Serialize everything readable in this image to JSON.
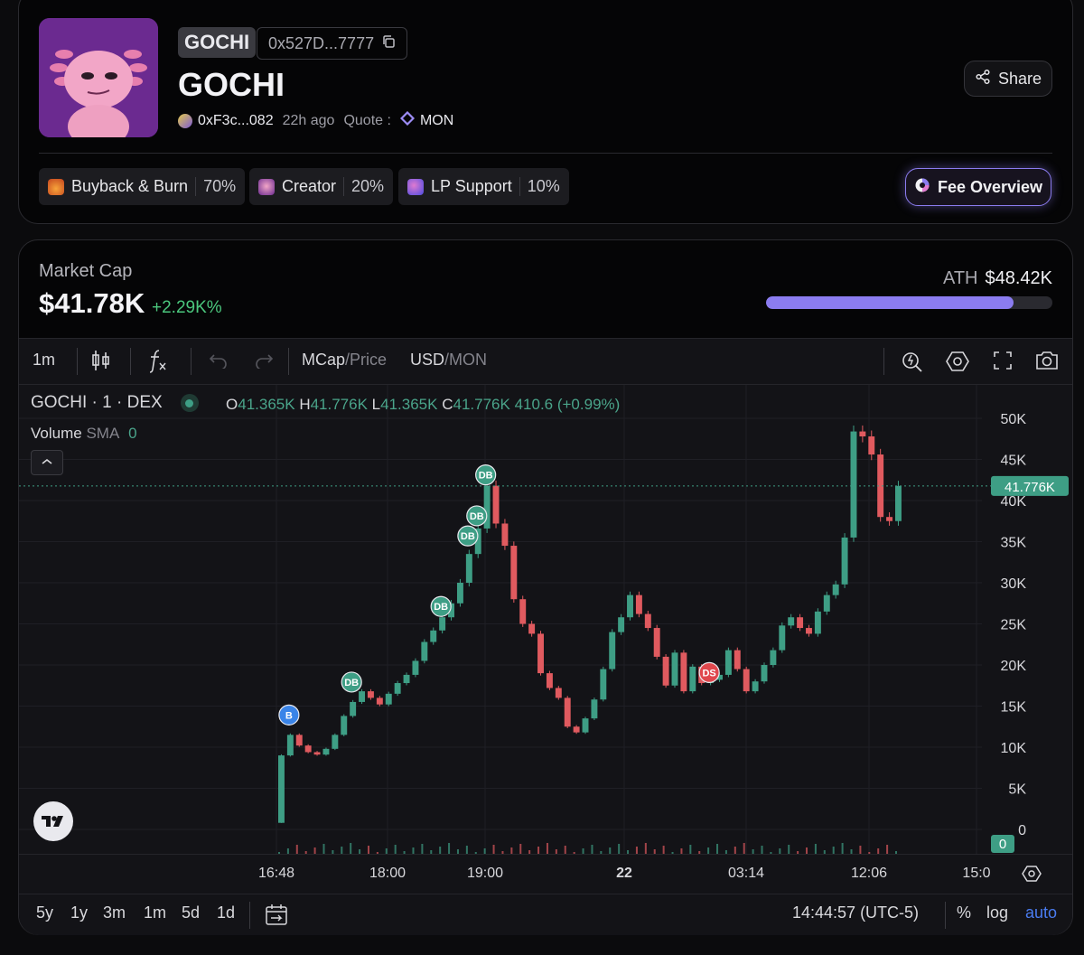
{
  "token": {
    "symbol": "GOCHI",
    "address_short": "0x527D...7777",
    "name": "GOCHI",
    "creator": "0xF3c...082",
    "age": "22h ago",
    "quote_label": "Quote :",
    "quote_value": "MON",
    "share_label": "Share"
  },
  "fees": [
    {
      "label": "Buyback & Burn",
      "pct": "70%",
      "icon": "fire-icon",
      "color": "#e0692a"
    },
    {
      "label": "Creator",
      "pct": "20%",
      "icon": "creator-avatar-icon",
      "color": "#b35cd8"
    },
    {
      "label": "LP Support",
      "pct": "10%",
      "icon": "lp-icon",
      "color": "#6a6ae8"
    }
  ],
  "fee_overview_label": "Fee Overview",
  "market": {
    "label": "Market Cap",
    "value": "$41.78K",
    "change": "+2.29K%",
    "ath_label": "ATH",
    "ath_value": "$48.42K",
    "ath_progress": 0.863
  },
  "toolbar": {
    "interval": "1m",
    "mcap": "MCap",
    "price": "Price",
    "usd": "USD",
    "mon": "MON",
    "slash": "/"
  },
  "legend": {
    "series": "GOCHI · 1 · DEX",
    "o_label": "O",
    "o": "41.365K",
    "h_label": "H",
    "h": "41.776K",
    "l_label": "L",
    "l": "41.365K",
    "c_label": "C",
    "c": "41.776K",
    "chg": "410.6 (+0.99%)",
    "volume_label": "Volume",
    "volume_sma": "SMA",
    "volume_value": "0"
  },
  "chart_data": {
    "type": "candlestick",
    "y_axis_ticks": [
      "50K",
      "45K",
      "40K",
      "35K",
      "30K",
      "25K",
      "20K",
      "15K",
      "10K",
      "5K",
      "0"
    ],
    "ylim": [
      0,
      50000
    ],
    "x_axis_ticks": [
      "16:48",
      "18:00",
      "19:00",
      "22",
      "03:14",
      "12:06",
      "15:0"
    ],
    "last_price_label": "41.776K",
    "volume_label": "0",
    "close_series": [
      9000,
      11500,
      10200,
      9400,
      9100,
      9800,
      11500,
      13800,
      15500,
      16800,
      16000,
      15200,
      16500,
      17800,
      18800,
      20500,
      22800,
      24200,
      25800,
      27500,
      30000,
      33500,
      36600,
      41800,
      37200,
      34500,
      28000,
      25000,
      23800,
      19000,
      17200,
      16000,
      12500,
      11800,
      13500,
      15800,
      19500,
      24000,
      25800,
      28500,
      26200,
      24500,
      21000,
      17500,
      21500,
      16800,
      19800,
      17800,
      18200,
      18800,
      21800,
      19500,
      16800,
      18000,
      20000,
      21800,
      24800,
      25800,
      24500,
      23800,
      26500,
      28500,
      29800,
      35500,
      48400,
      47800,
      45600,
      38000,
      37500,
      41776
    ],
    "markers": [
      {
        "label": "B",
        "type": "buy"
      },
      {
        "label": "DB",
        "type": "dev-buy"
      },
      {
        "label": "DB",
        "type": "dev-buy"
      },
      {
        "label": "DB",
        "type": "dev-buy"
      },
      {
        "label": "DB",
        "type": "dev-buy"
      },
      {
        "label": "DB",
        "type": "dev-buy"
      },
      {
        "label": "DS",
        "type": "dev-sell"
      }
    ],
    "colors": {
      "up": "#3e9e85",
      "down": "#e05a5f",
      "buy": "#3a84e8",
      "dev_buy": "#3e9e85",
      "dev_sell": "#e0474d"
    }
  },
  "range_buttons": [
    "5y",
    "1y",
    "3m",
    "1m",
    "5d",
    "1d"
  ],
  "bottom": {
    "time": "14:44:57 (UTC-5)",
    "percent": "%",
    "log": "log",
    "auto": "auto"
  }
}
